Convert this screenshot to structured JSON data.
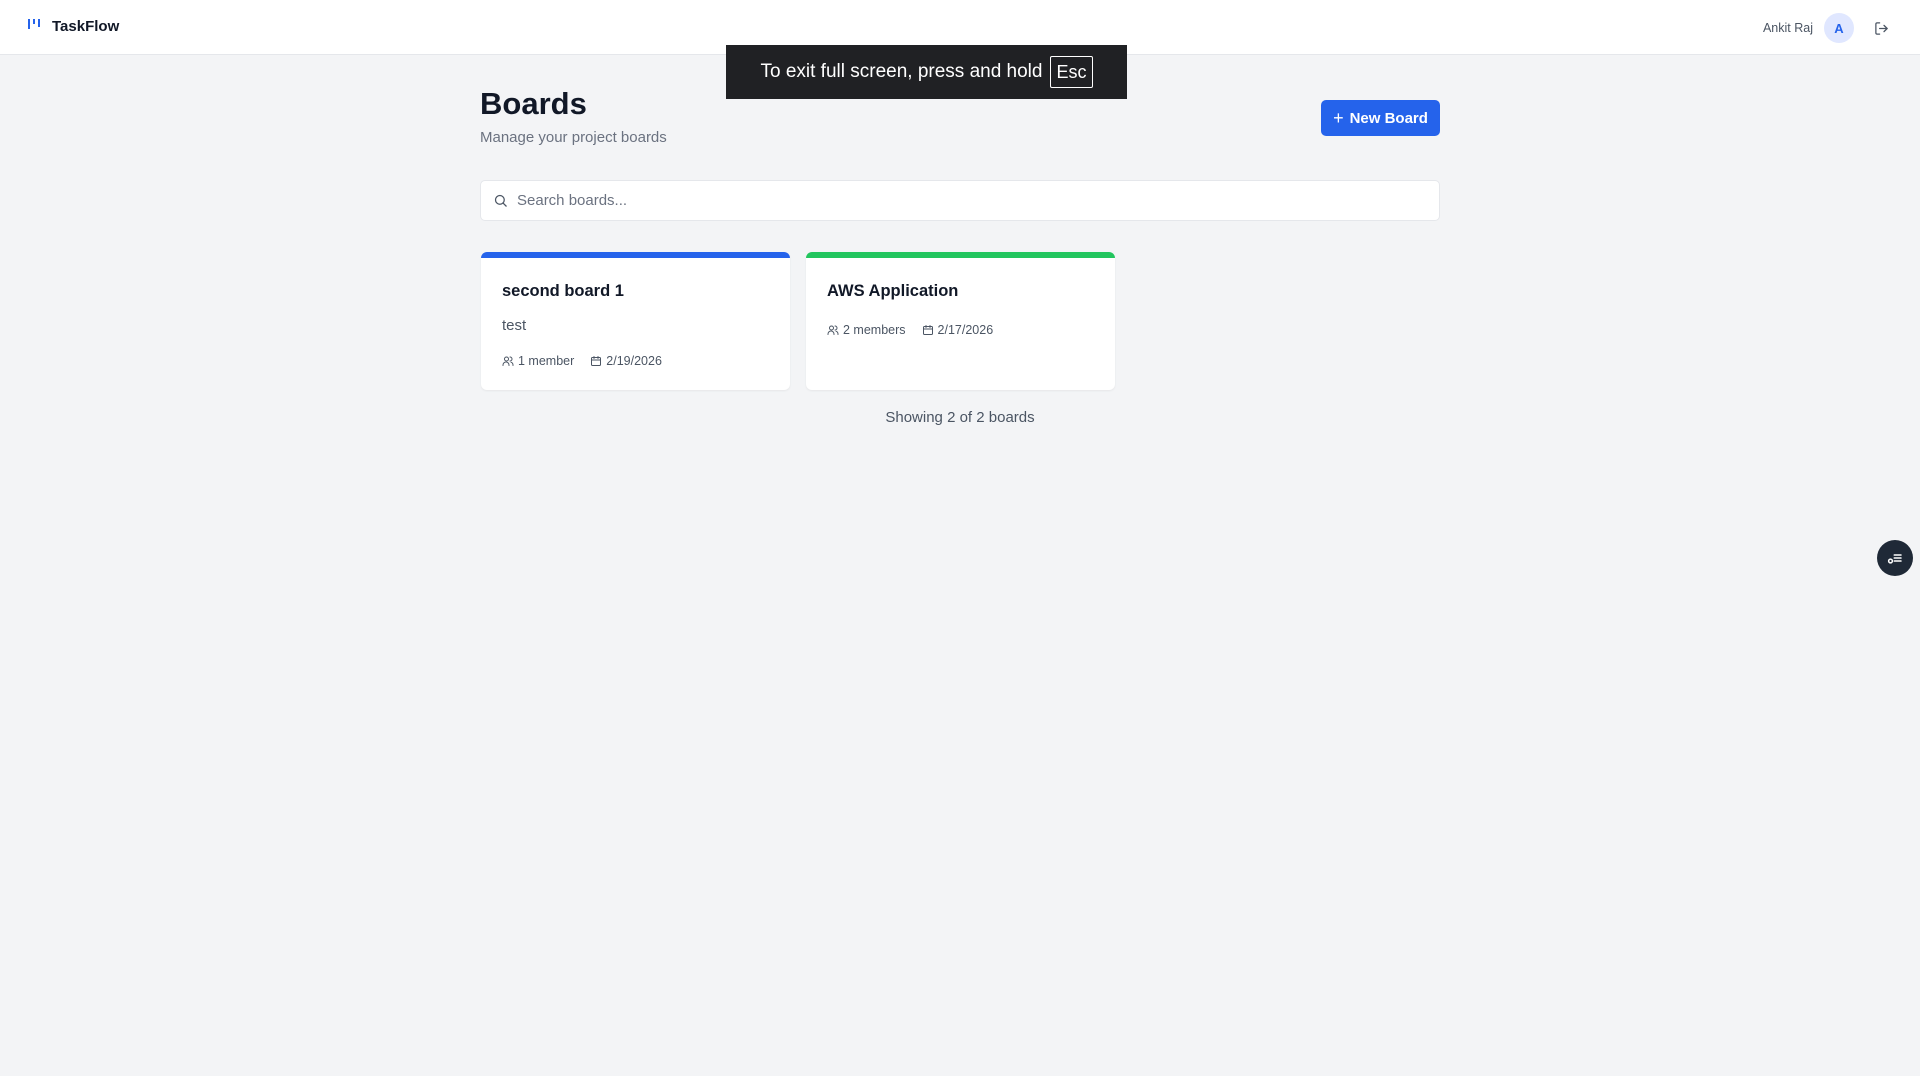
{
  "app": {
    "name": "TaskFlow"
  },
  "user": {
    "name": "Ankit Raj",
    "initial": "A"
  },
  "fullscreen_notice": {
    "text": "To exit full screen, press and hold",
    "key": "Esc"
  },
  "page": {
    "title": "Boards",
    "subtitle": "Manage your project boards",
    "new_board_label": "New Board"
  },
  "search": {
    "placeholder": "Search boards...",
    "value": ""
  },
  "boards": [
    {
      "title": "second board 1",
      "description": "test",
      "members": "1 member",
      "date": "2/19/2026",
      "accent": "#2563eb"
    },
    {
      "title": "AWS Application",
      "description": "",
      "members": "2 members",
      "date": "2/17/2026",
      "accent": "#22c55e"
    }
  ],
  "footer": {
    "showing": "Showing 2 of 2 boards"
  },
  "icons": [
    "board-logo-icon",
    "logout-icon",
    "plus-icon",
    "search-icon",
    "users-icon",
    "calendar-icon",
    "assistant-icon"
  ],
  "colors": {
    "primary": "#2563eb",
    "success": "#22c55e",
    "background": "#f3f4f6"
  }
}
